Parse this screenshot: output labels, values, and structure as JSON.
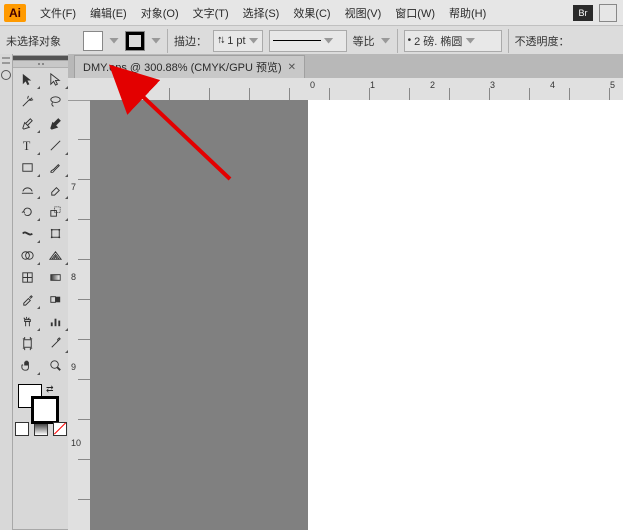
{
  "menu": {
    "file": "文件(F)",
    "edit": "编辑(E)",
    "object": "对象(O)",
    "type": "文字(T)",
    "select": "选择(S)",
    "effect": "效果(C)",
    "view": "视图(V)",
    "window": "窗口(W)",
    "help": "帮助(H)",
    "br": "Br"
  },
  "props": {
    "no_selection": "未选择对象",
    "stroke_label": "描边：",
    "stroke_val": "1 pt",
    "scale_label": "等比",
    "weight_label": "2 磅. 椭圆",
    "opacity_label": "不透明度："
  },
  "tab": {
    "title": "DMY.eps @ 300.88% (CMYK/GPU 预览)"
  },
  "ruler_h": [
    "0",
    "1",
    "2",
    "3",
    "4",
    "5"
  ],
  "ruler_v": [
    "7",
    "8",
    "9",
    "10"
  ]
}
